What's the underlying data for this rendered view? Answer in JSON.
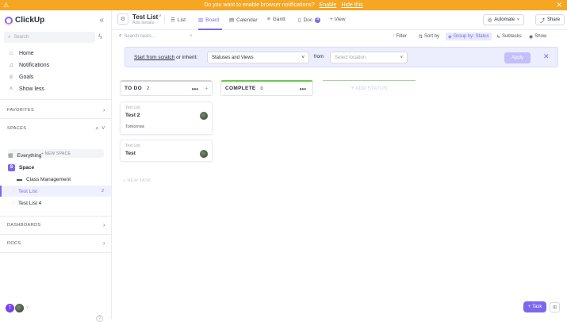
{
  "banner": {
    "message": "Do you want to enable browser notifications?",
    "enable": "Enable",
    "hide": "Hide this"
  },
  "sidebar": {
    "brand": "ClickUp",
    "search_placeholder": "Search",
    "nav": [
      {
        "label": "Home",
        "icon": "home-icon"
      },
      {
        "label": "Notifications",
        "icon": "bell-icon"
      },
      {
        "label": "Goals",
        "icon": "trophy-icon"
      },
      {
        "label": "Show less",
        "icon": "chevron-up-icon"
      }
    ],
    "favorites": "FAVORITES",
    "spaces": "SPACES",
    "new_space": "+ NEW SPACE",
    "everything": "Everything",
    "space": {
      "letter": "S",
      "name": "Space"
    },
    "folder": "Class Management",
    "lists": [
      {
        "name": "Test List",
        "count": "2"
      },
      {
        "name": "Test List 4",
        "count": ""
      }
    ],
    "dashboards": "DASHBOARDS",
    "docs": "DOCS",
    "user_initial": "T"
  },
  "header": {
    "list_title": "Test List",
    "list_sub": "Add details",
    "tabs": {
      "list": "List",
      "board": "Board",
      "calendar": "Calendar",
      "gantt": "Gantt",
      "doc": "Doc",
      "doc_count": "4",
      "add_view": "+ View"
    },
    "automate": "Automate",
    "share": "Share"
  },
  "toolbar": {
    "search_placeholder": "Search tasks...",
    "filter": "Filter",
    "sort": "Sort by",
    "group": "Group by: Status",
    "subtasks": "Subtasks",
    "show": "Show"
  },
  "template_bar": {
    "start_link": "Start from scratch",
    "or_inherit": "or inherit:",
    "select_value": "Statuses and Views",
    "from": "from",
    "location_placeholder": "Select location",
    "apply": "Apply"
  },
  "board": {
    "columns": [
      {
        "name": "TO DO",
        "count": "2",
        "color": "#d3d3d3"
      },
      {
        "name": "COMPLETE",
        "count": "0",
        "color": "#6bc950"
      }
    ],
    "add_status": "+ ADD STATUS",
    "cards": [
      {
        "list": "Test List",
        "title": "Test 2",
        "date": "Tomorrow"
      },
      {
        "list": "Test List",
        "title": "Test",
        "date": ""
      }
    ],
    "new_task": "+ NEW TASK"
  },
  "fab": {
    "label": "Task"
  }
}
